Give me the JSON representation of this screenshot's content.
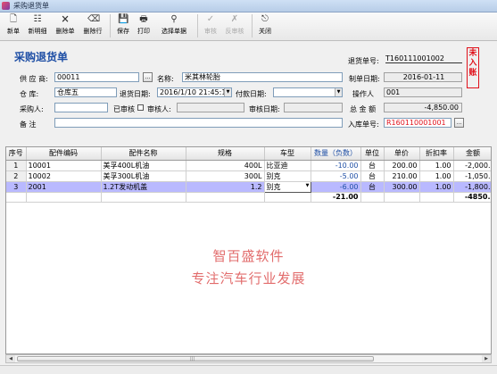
{
  "window": {
    "title": "采购退货单"
  },
  "toolbar": {
    "buttons": [
      {
        "label": "新单",
        "icon": "new-doc-icon",
        "glyph": "🗋"
      },
      {
        "label": "新明细",
        "icon": "new-detail-icon",
        "glyph": "☷"
      },
      {
        "label": "删除单",
        "icon": "delete-doc-icon",
        "glyph": "🗙"
      },
      {
        "label": "删除行",
        "icon": "delete-row-icon",
        "glyph": "⌫"
      },
      {
        "label": "保存",
        "icon": "save-icon",
        "glyph": "💾"
      },
      {
        "label": "打印",
        "icon": "print-icon",
        "glyph": "🖶"
      },
      {
        "label": "选择单据",
        "icon": "binoculars-icon",
        "glyph": "⚲"
      },
      {
        "label": "审核",
        "icon": "audit-icon",
        "glyph": "✓"
      },
      {
        "label": "反审核",
        "icon": "unaudit-icon",
        "glyph": "✗"
      },
      {
        "label": "关闭",
        "icon": "exit-icon",
        "glyph": "⎋"
      }
    ]
  },
  "form": {
    "title": "采购退货单",
    "doc_no_label": "退货单号:",
    "doc_no": "T160111001002",
    "stamp": "未入账",
    "supplier_label": "供 应 商:",
    "supplier_code": "00011",
    "name_label": "名称:",
    "supplier_name": "米其林轮胎",
    "date_label": "制单日期:",
    "date": "2016-01-11",
    "warehouse_label": "仓    库:",
    "warehouse": "仓库五",
    "return_date_label": "退货日期:",
    "return_date": "2016/1/10 21:45:10",
    "pay_date_label": "付款日期:",
    "pay_date": "",
    "operator_label": "操作人",
    "operator": "001",
    "purchaser_label": "采购人:",
    "purchaser": "",
    "audited_label": "已审核",
    "auditor_label": "审核人:",
    "auditor": "",
    "audit_date_label": "审核日期:",
    "audit_date": "",
    "total_label": "总 金 额",
    "total": "-4,850.00",
    "remark_label": "备    注",
    "remark": "",
    "inbound_label": "入库单号:",
    "inbound_no": "R160110001001"
  },
  "grid": {
    "columns": [
      "序号",
      "配件编码",
      "配件名称",
      "规格",
      "车型",
      "数量（负数）",
      "单位",
      "单价",
      "折扣率",
      "金额"
    ],
    "rows": [
      {
        "no": "1",
        "code": "10001",
        "name": "美孚400L机油",
        "spec": "400L",
        "model": "比亚迪",
        "qty": "-10.00",
        "unit": "台",
        "price": "200.00",
        "discount": "1.00",
        "amount": "-2,000."
      },
      {
        "no": "2",
        "code": "10002",
        "name": "美孚300L机油",
        "spec": "300L",
        "model": "别克",
        "qty": "-5.00",
        "unit": "台",
        "price": "210.00",
        "discount": "1.00",
        "amount": "-1,050."
      },
      {
        "no": "3",
        "code": "2001",
        "name": "1.2T发动机盖",
        "spec": "1.2",
        "model": "别克",
        "qty": "-6.00",
        "unit": "台",
        "price": "300.00",
        "discount": "1.00",
        "amount": "-1,800."
      }
    ],
    "totals": {
      "qty": "-21.00",
      "amount": "-4850."
    }
  },
  "watermark": {
    "line1": "智百盛软件",
    "line2": "专注汽车行业发展"
  },
  "colors": {
    "title_blue": "#1f4fa5",
    "selected_row": "#b9b9ff",
    "stamp_red": "#e0101a",
    "watermark": "#e26c6c"
  }
}
